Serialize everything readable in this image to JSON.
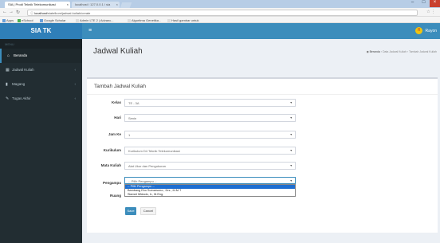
{
  "browser": {
    "tabs": [
      {
        "label": "SIA | Prodi Teknik Telekomunikasi"
      },
      {
        "label": "localhost / 127.0.0.1 / sia"
      }
    ],
    "url_host": "localhost",
    "url_path": "/siatelkom/jadwal-kuliah/create",
    "bookmarks": [
      "Apps",
      "eSchool",
      "Google Scholar",
      "Admin LTE 2 | Advanc...",
      "Algoritma Genetika -",
      "Hasil gambar untuk"
    ]
  },
  "app": {
    "brand": "SIA TK",
    "user_name": "Rayon",
    "user_initial": "R"
  },
  "sidebar": {
    "header": "MENU",
    "items": [
      {
        "label": "Beranda",
        "icon": "home-icon"
      },
      {
        "label": "Jadwal Kuliah",
        "icon": "table-icon"
      },
      {
        "label": "Magang",
        "icon": "chart-icon"
      },
      {
        "label": "Tugas Akhir",
        "icon": "pen-icon"
      }
    ]
  },
  "page": {
    "title": "Jadwal Kuliah",
    "breadcrumb": [
      "Beranda",
      "Data Jadwal Kuliah",
      "Tambah Jadwal Kuliah"
    ]
  },
  "form": {
    "title": "Tambah Jadwal Kuliah",
    "fields": [
      {
        "label": "Kelas",
        "value": "TE - 3A"
      },
      {
        "label": "Hari",
        "value": "Senin"
      },
      {
        "label": "Jam Ke",
        "value": "1"
      },
      {
        "label": "Kurikulum",
        "value": "Kurikulum D4 Teknik Telekomunikasi"
      },
      {
        "label": "Mata Kuliah",
        "value": "Alat Ukur dan Pengukuran"
      },
      {
        "label": "Pengampu",
        "value": "-- Pilih Pengampu --"
      },
      {
        "label": "Ruang",
        "value": ""
      }
    ],
    "pengampu_options": [
      "-- Pilih Pengampu --",
      "Bambang Eko Sumarsono., Drs., M.M.T",
      "Slamet Widodo, Ir., M.Eng."
    ],
    "save_label": "Save",
    "cancel_label": "Cancel"
  }
}
